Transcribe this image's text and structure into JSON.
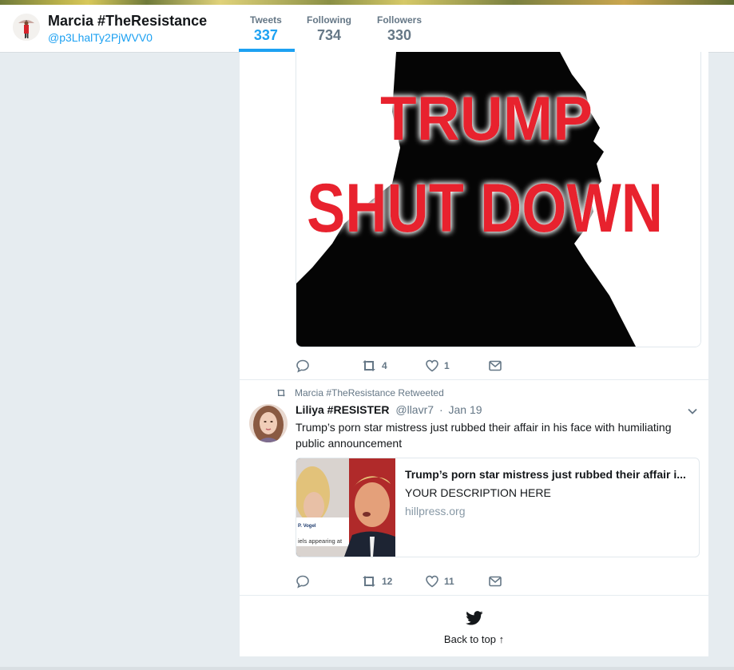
{
  "profile": {
    "name": "Marcia #TheResistance",
    "handle": "@p3LhalTy2PjWVV0"
  },
  "nav": {
    "tweets_label": "Tweets",
    "tweets_count": "337",
    "following_label": "Following",
    "following_count": "734",
    "followers_label": "Followers",
    "followers_count": "330"
  },
  "tweet1": {
    "image_text_line1": "TRUMP",
    "image_text_line2": "SHUT DOWN",
    "retweet_count": "4",
    "like_count": "1"
  },
  "tweet2": {
    "context": "Marcia #TheResistance Retweeted",
    "author_name": "Liliya #RESISTER",
    "author_handle": "@llavr7",
    "separator": "·",
    "time": "Jan 19",
    "text": "Trump’s porn star mistress just rubbed their affair in his face with humiliating public announcement",
    "card": {
      "title": "Trump’s porn star mistress just rubbed their affair i...",
      "description": "YOUR DESCRIPTION HERE",
      "domain": "hillpress.org",
      "thumb_caption1": "P. Vogel",
      "thumb_caption2": "iels appearing at"
    },
    "retweet_count": "12",
    "like_count": "11"
  },
  "footer": {
    "back_to_top": "Back to top ↑"
  },
  "colors": {
    "accent": "#1da1f2",
    "muted": "#657786",
    "background": "#e6ecf0",
    "image_red": "#e8202e"
  },
  "icons": [
    "reply-icon",
    "retweet-icon",
    "like-icon",
    "direct-message-icon",
    "chevron-down-icon",
    "twitter-bird-icon"
  ]
}
